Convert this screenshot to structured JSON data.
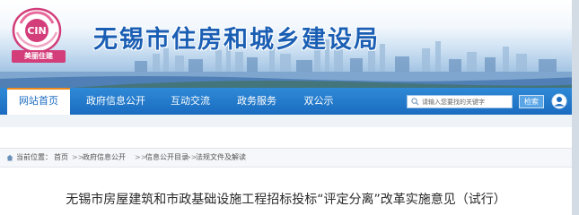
{
  "logo": {
    "badge_text": "CIN",
    "caption": "美丽住建"
  },
  "header": {
    "title": "无锡市住房和城乡建设局"
  },
  "nav": {
    "items": [
      {
        "label": "网站首页",
        "active": true
      },
      {
        "label": "政府信息公开",
        "active": false
      },
      {
        "label": "互动交流",
        "active": false
      },
      {
        "label": "政务服务",
        "active": false
      },
      {
        "label": "双公示",
        "active": false
      }
    ]
  },
  "search": {
    "placeholder": "请输入您要找的关键字",
    "button_label": "检索"
  },
  "breadcrumb": {
    "prefix": "当前位置：",
    "items": [
      "首页",
      "政府信息公开",
      "信息公开目录",
      "法规文件及解读"
    ],
    "separator": ">>"
  },
  "article": {
    "title": "无锡市房屋建筑和市政基础设施工程招标投标“评定分离”改革实施意见（试行）"
  },
  "colors": {
    "nav_bg": "#1a6bc0",
    "title_blue": "#1b5fb4",
    "logo_pink": "#d23d7a"
  }
}
